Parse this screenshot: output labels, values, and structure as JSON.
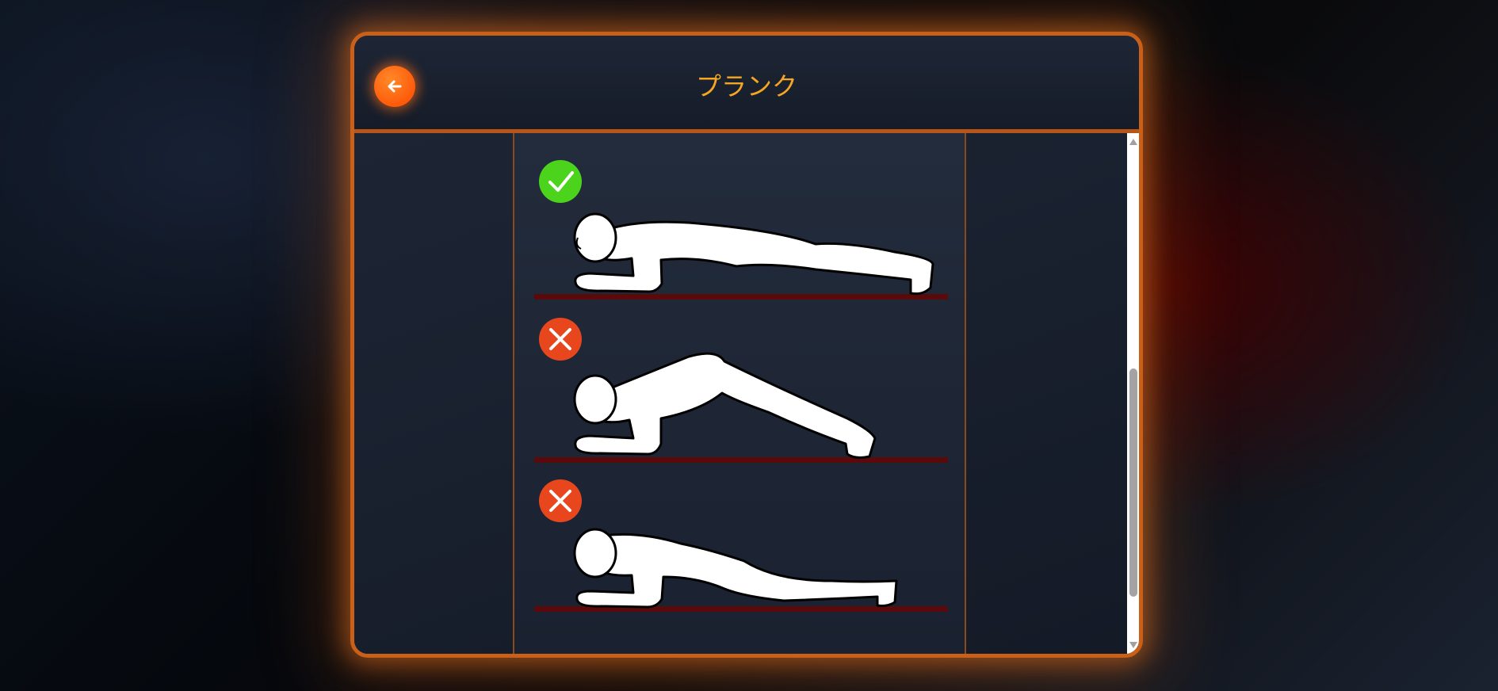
{
  "header": {
    "title": "プランク",
    "back_icon": "arrow-left-icon"
  },
  "colors": {
    "accent": "#f5a623",
    "border": "#c8601a",
    "correct": "#4cd41c",
    "incorrect": "#e8461c",
    "floor": "#5a0a0a"
  },
  "illustration": {
    "rows": [
      {
        "status": "correct",
        "icon": "check-icon",
        "pose": "straight-plank"
      },
      {
        "status": "incorrect",
        "icon": "x-icon",
        "pose": "hips-too-high"
      },
      {
        "status": "incorrect",
        "icon": "x-icon",
        "pose": "hips-sagging"
      }
    ]
  },
  "scrollbar": {
    "position_fraction": 0.55
  }
}
